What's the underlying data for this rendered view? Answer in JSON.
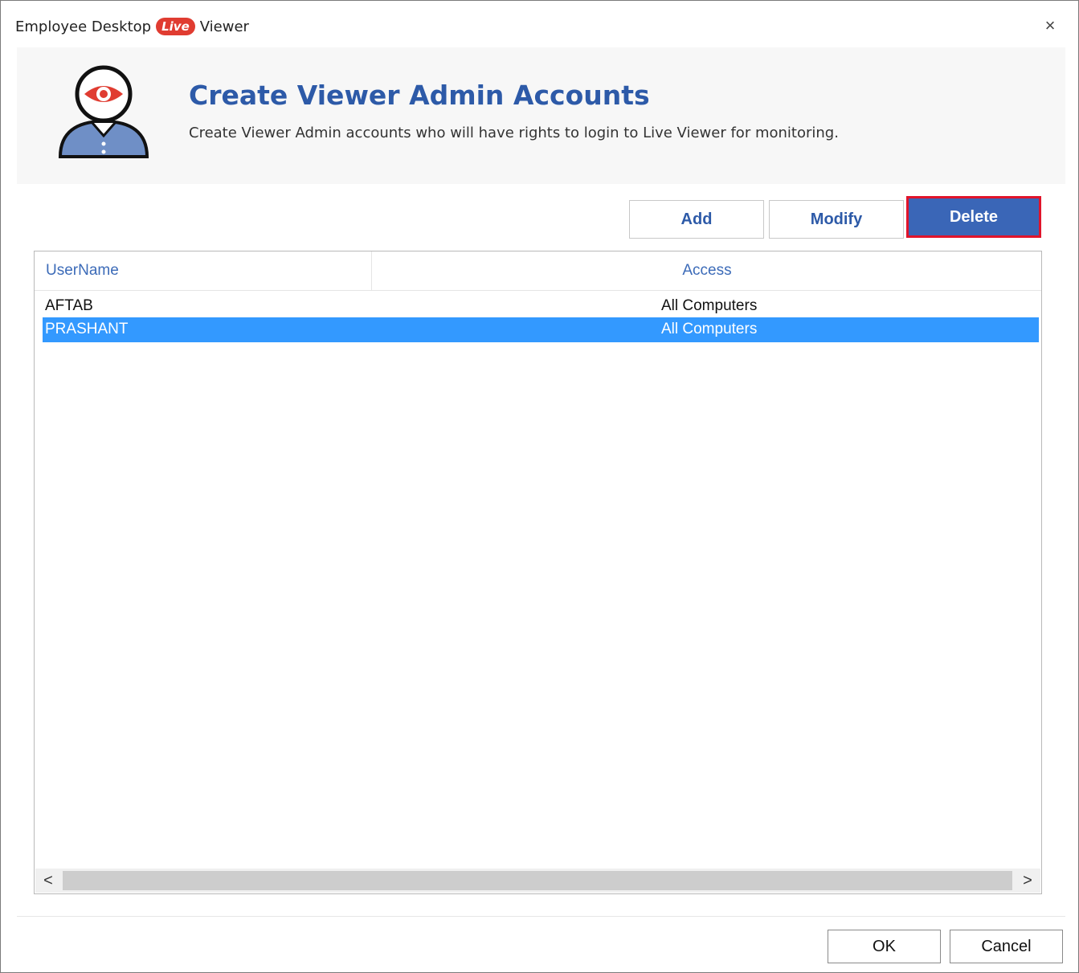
{
  "window": {
    "title_before": "Employee Desktop",
    "title_badge": "Live",
    "title_after": "Viewer",
    "close_label": "×"
  },
  "header": {
    "title": "Create Viewer Admin Accounts",
    "subtitle": "Create Viewer Admin accounts who will have rights to login to Live Viewer for monitoring."
  },
  "toolbar": {
    "add_label": "Add",
    "modify_label": "Modify",
    "delete_label": "Delete"
  },
  "table": {
    "columns": [
      "UserName",
      "Access"
    ],
    "rows": [
      {
        "username": "AFTAB",
        "access": "All Computers"
      },
      {
        "username": "PRASHANT",
        "access": "All Computers"
      }
    ],
    "selected_index": 1
  },
  "scrollbar": {
    "left_arrow": "<",
    "right_arrow": ">"
  },
  "footer": {
    "ok_label": "OK",
    "cancel_label": "Cancel"
  },
  "colors": {
    "accent": "#2d5aa8",
    "live_badge": "#e03c31",
    "selection": "#3399ff",
    "delete_highlight": "#e0142b"
  }
}
